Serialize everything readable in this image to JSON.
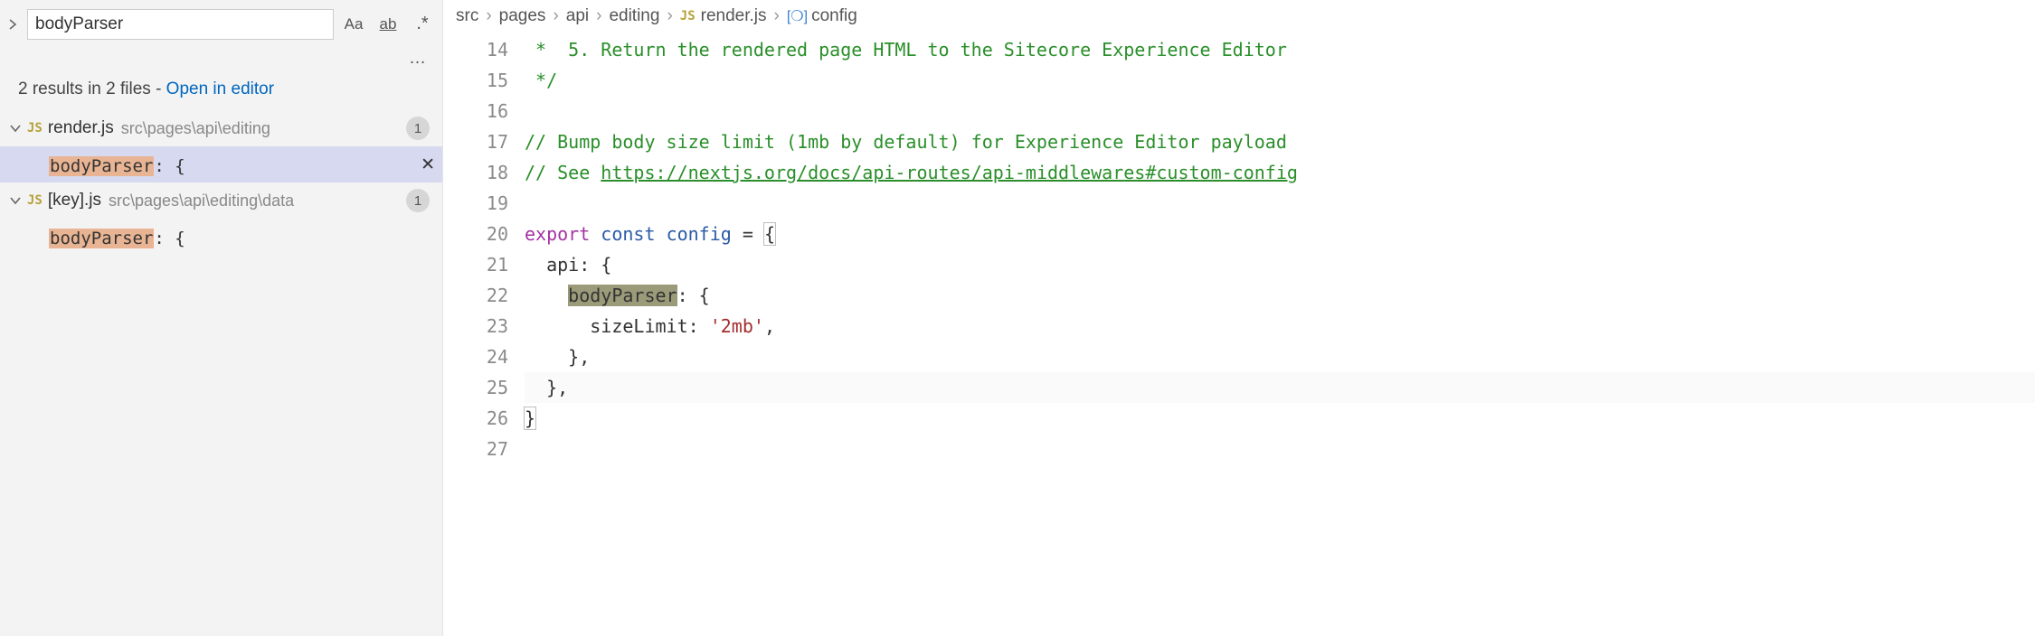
{
  "search": {
    "query": "bodyParser",
    "options": {
      "matchCase": "Aa",
      "wholeWord": "ab",
      "regex": ".*"
    },
    "more": "…",
    "summaryPrefix": "2 results in 2 files - ",
    "summaryLink": "Open in editor"
  },
  "results": [
    {
      "fileName": "render.js",
      "filePath": "src\\pages\\api\\editing",
      "badge": "1",
      "expanded": true,
      "selected": true,
      "matches": [
        {
          "highlight": "bodyParser",
          "suffix": ": {",
          "selected": true
        }
      ]
    },
    {
      "fileName": "[key].js",
      "filePath": "src\\pages\\api\\editing\\data",
      "badge": "1",
      "expanded": true,
      "matches": [
        {
          "highlight": "bodyParser",
          "suffix": ": {"
        }
      ]
    }
  ],
  "breadcrumbs": {
    "parts": [
      "src",
      "pages",
      "api",
      "editing"
    ],
    "fileName": "render.js",
    "symbol": "config"
  },
  "editor": {
    "lines": [
      {
        "n": 14,
        "type": "comment",
        "text": " *  5. Return the rendered page HTML to the Sitecore Experience Editor"
      },
      {
        "n": 15,
        "type": "comment",
        "text": " */"
      },
      {
        "n": 16,
        "type": "blank",
        "text": ""
      },
      {
        "n": 17,
        "type": "comment",
        "text": "// Bump body size limit (1mb by default) for Experience Editor payload"
      },
      {
        "n": 18,
        "type": "comment-url",
        "prefix": "// See ",
        "url": "https://nextjs.org/docs/api-routes/api-middlewares#custom-config"
      },
      {
        "n": 19,
        "type": "blank",
        "text": ""
      },
      {
        "n": 20,
        "type": "export",
        "kwExport": "export",
        "kwConst": "const",
        "varName": "config",
        "eq": " = ",
        "brace": "{"
      },
      {
        "n": 21,
        "type": "key-open",
        "indent": "  ",
        "key": "api",
        "post": ": {"
      },
      {
        "n": 22,
        "type": "key-open-hl",
        "indent": "    ",
        "key": "bodyParser",
        "post": ": {"
      },
      {
        "n": 23,
        "type": "kv-str",
        "indent": "      ",
        "key": "sizeLimit",
        "colon": ": ",
        "str": "'2mb'",
        "comma": ","
      },
      {
        "n": 24,
        "type": "close",
        "indent": "    ",
        "text": "},"
      },
      {
        "n": 25,
        "type": "close",
        "indent": "  ",
        "text": "},",
        "cursorLine": true
      },
      {
        "n": 26,
        "type": "close-match",
        "indent": "",
        "text": "}"
      },
      {
        "n": 27,
        "type": "blank",
        "text": ""
      }
    ]
  }
}
